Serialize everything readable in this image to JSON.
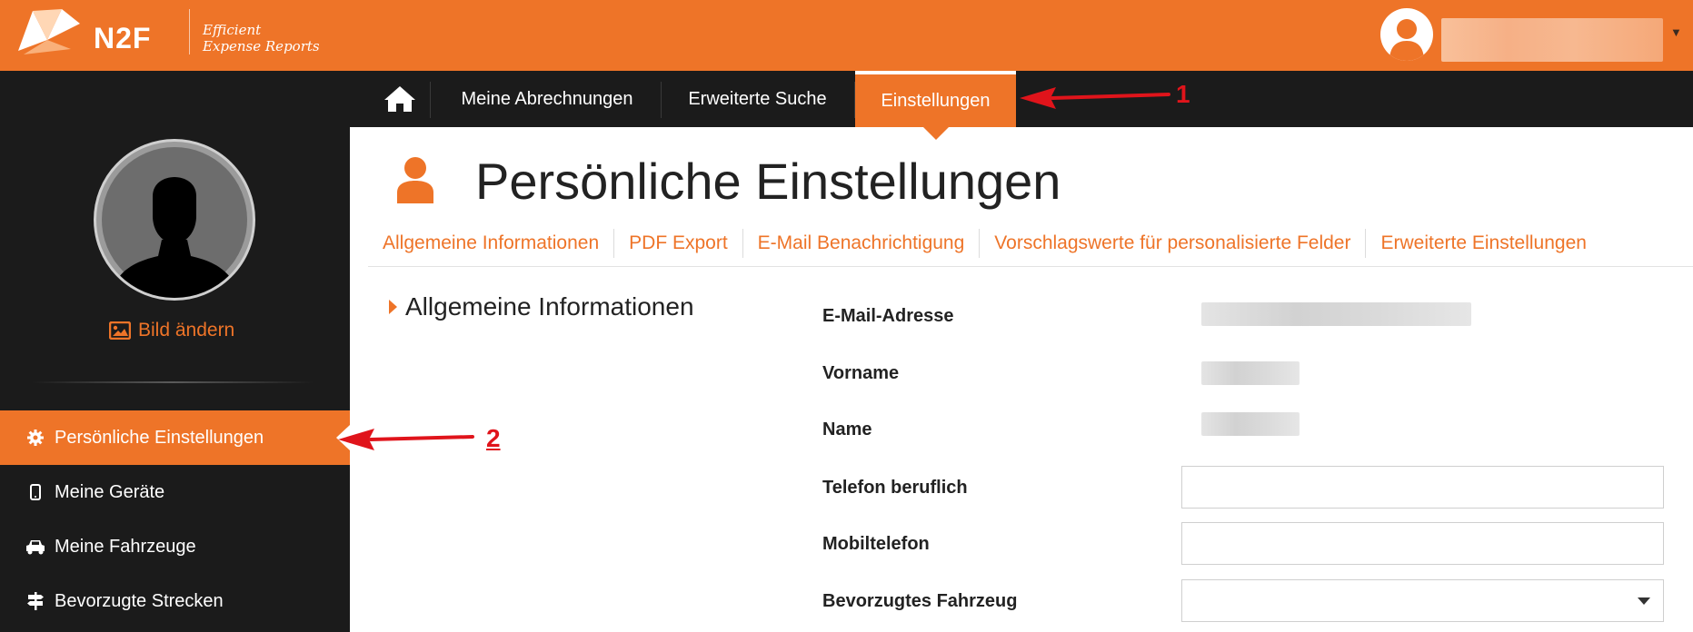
{
  "header": {
    "brand": "N2F",
    "tagline_line1": "Efficient",
    "tagline_line2": "Expense Reports"
  },
  "nav": {
    "items": [
      {
        "label": "Meine Abrechnungen"
      },
      {
        "label": "Erweiterte Suche"
      },
      {
        "label": "Einstellungen",
        "active": true
      }
    ]
  },
  "sidebar": {
    "change_picture": "Bild ändern",
    "items": [
      {
        "label": "Persönliche Einstellungen",
        "icon": "gear-icon",
        "active": true
      },
      {
        "label": "Meine Geräte",
        "icon": "mobile-icon"
      },
      {
        "label": "Meine Fahrzeuge",
        "icon": "car-icon"
      },
      {
        "label": "Bevorzugte Strecken",
        "icon": "signpost-icon"
      }
    ]
  },
  "main": {
    "title": "Persönliche Einstellungen",
    "tabs": [
      {
        "label": "Allgemeine Informationen"
      },
      {
        "label": "PDF Export"
      },
      {
        "label": "E-Mail Benachrichtigung"
      },
      {
        "label": "Vorschlagswerte für personalisierte Felder"
      },
      {
        "label": "Erweiterte Einstellungen"
      }
    ],
    "section_title": "Allgemeine Informationen",
    "fields": {
      "email": {
        "label": "E-Mail-Adresse",
        "value": ""
      },
      "firstname": {
        "label": "Vorname",
        "value": ""
      },
      "lastname": {
        "label": "Name",
        "value": ""
      },
      "work_phone": {
        "label": "Telefon beruflich",
        "value": ""
      },
      "mobile_phone": {
        "label": "Mobiltelefon",
        "value": ""
      },
      "preferred_vehicle": {
        "label": "Bevorzugtes Fahrzeug",
        "value": ""
      }
    }
  },
  "annotations": {
    "marker1": "1",
    "marker2": "2"
  },
  "colors": {
    "accent": "#ee7428",
    "dark": "#1b1b1b",
    "annotation": "#e0141b"
  }
}
